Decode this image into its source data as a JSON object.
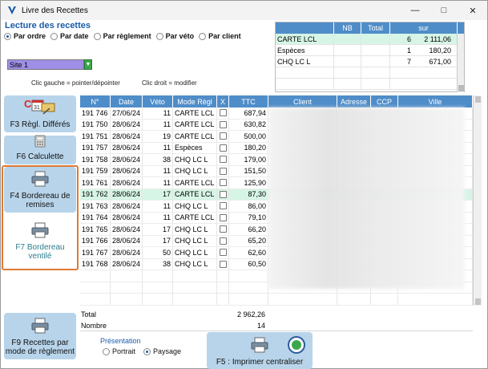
{
  "window": {
    "title": "Livre des Recettes"
  },
  "lecture": {
    "title": "Lecture des recettes",
    "options": [
      {
        "label": "Par ordre",
        "selected": true
      },
      {
        "label": "Par date",
        "selected": false
      },
      {
        "label": "Par règlement",
        "selected": false
      },
      {
        "label": "Par véto",
        "selected": false
      },
      {
        "label": "Par client",
        "selected": false
      }
    ]
  },
  "summary": {
    "headers": [
      "",
      "NB",
      "Total",
      "sur"
    ],
    "rows": [
      {
        "name": "CARTE LCL",
        "nb": "6",
        "total": "2 111,06"
      },
      {
        "name": "Espèces",
        "nb": "1",
        "total": "180,20"
      },
      {
        "name": "CHQ  LC L",
        "nb": "7",
        "total": "671,00"
      }
    ]
  },
  "site": {
    "value": "Site 1"
  },
  "hints": {
    "left": "Clic gauche = pointer/dépointer",
    "right": "Clic droit = modifier"
  },
  "sidebar": {
    "f3": "F3 Règl. Différés",
    "f6": "F6 Calculette",
    "f4": "F4 Bordereau de remises",
    "f7": "F7 Bordereau ventilé",
    "f9": "F9 Recettes par mode de règlement"
  },
  "grid": {
    "headers": [
      "N°",
      "Date",
      "Véto",
      "Mode Règl",
      "X",
      "TTC",
      "Client",
      "Adresse",
      "CCP",
      "Ville"
    ],
    "rows": [
      {
        "num": "191 746",
        "date": "27/06/24",
        "veto": "11",
        "mode": "CARTE LCL",
        "ttc": "687,94"
      },
      {
        "num": "191 750",
        "date": "28/06/24",
        "veto": "11",
        "mode": "CARTE LCL",
        "ttc": "630,82"
      },
      {
        "num": "191 751",
        "date": "28/06/24",
        "veto": "19",
        "mode": "CARTE LCL",
        "ttc": "500,00"
      },
      {
        "num": "191 757",
        "date": "28/06/24",
        "veto": "11",
        "mode": "Espèces",
        "ttc": "180,20"
      },
      {
        "num": "191 758",
        "date": "28/06/24",
        "veto": "38",
        "mode": "CHQ  LC L",
        "ttc": "179,00"
      },
      {
        "num": "191 759",
        "date": "28/06/24",
        "veto": "11",
        "mode": "CHQ  LC L",
        "ttc": "151,50"
      },
      {
        "num": "191 761",
        "date": "28/06/24",
        "veto": "11",
        "mode": "CARTE LCL",
        "ttc": "125,90"
      },
      {
        "num": "191 762",
        "date": "28/06/24",
        "veto": "17",
        "mode": "CARTE LCL",
        "ttc": "87,30"
      },
      {
        "num": "191 763",
        "date": "28/06/24",
        "veto": "11",
        "mode": "CHQ  LC L",
        "ttc": "86,00"
      },
      {
        "num": "191 764",
        "date": "28/06/24",
        "veto": "11",
        "mode": "CARTE LCL",
        "ttc": "79,10"
      },
      {
        "num": "191 765",
        "date": "28/06/24",
        "veto": "17",
        "mode": "CHQ  LC L",
        "ttc": "66,20"
      },
      {
        "num": "191 766",
        "date": "28/06/24",
        "veto": "17",
        "mode": "CHQ  LC L",
        "ttc": "65,20"
      },
      {
        "num": "191 767",
        "date": "28/06/24",
        "veto": "50",
        "mode": "CHQ  LC L",
        "ttc": "62,60"
      },
      {
        "num": "191 768",
        "date": "28/06/24",
        "veto": "38",
        "mode": "CHQ  LC L",
        "ttc": "60,50"
      }
    ],
    "selected_index": 7
  },
  "totals": {
    "total_label": "Total",
    "total_value": "2 962,26",
    "count_label": "Nombre",
    "count_value": "14"
  },
  "presentation": {
    "label": "Présentation",
    "portrait": "Portrait",
    "paysage": "Paysage"
  },
  "print": {
    "label": "F5 : Imprimer centraliser"
  },
  "colors": {
    "header_blue": "#4f8dc9",
    "selected_row": "#d6f5e6",
    "button_blue": "#b8d4ea",
    "highlight_orange": "#e07a30"
  }
}
